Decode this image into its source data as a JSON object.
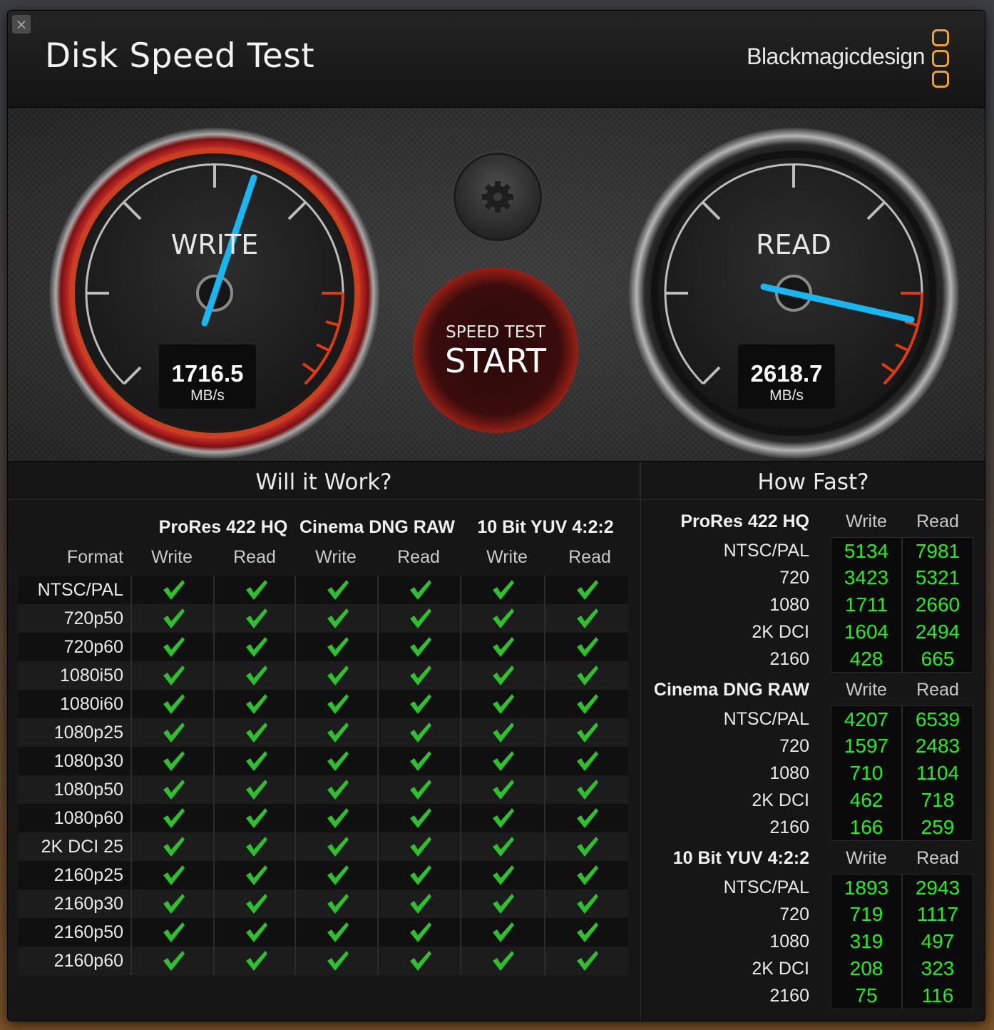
{
  "app": {
    "title": "Disk Speed Test",
    "brand": "Blackmagicdesign",
    "accent_color": "#f0a030"
  },
  "gauges": {
    "write": {
      "label": "WRITE",
      "value": "1716.5",
      "unit": "MB/s",
      "ring_color": "#c42a2a",
      "needle_color": "#1ab6f0"
    },
    "read": {
      "label": "READ",
      "value": "2618.7",
      "unit": "MB/s",
      "ring_color": "#2a2a2a",
      "needle_color": "#1ab6f0"
    }
  },
  "start_button": {
    "subtitle": "SPEED TEST",
    "label": "START"
  },
  "settings_icon": "gear-icon",
  "will_it_work": {
    "title": "Will it Work?",
    "format_header": "Format",
    "groups": [
      "ProRes 422 HQ",
      "Cinema DNG RAW",
      "10 Bit YUV 4:2:2"
    ],
    "subheaders": [
      "Write",
      "Read",
      "Write",
      "Read",
      "Write",
      "Read"
    ],
    "rows": [
      {
        "format": "NTSC/PAL"
      },
      {
        "format": "720p50"
      },
      {
        "format": "720p60"
      },
      {
        "format": "1080i50"
      },
      {
        "format": "1080i60"
      },
      {
        "format": "1080p25"
      },
      {
        "format": "1080p30"
      },
      {
        "format": "1080p50"
      },
      {
        "format": "1080p60"
      },
      {
        "format": "2K DCI 25"
      },
      {
        "format": "2160p25"
      },
      {
        "format": "2160p30"
      },
      {
        "format": "2160p50"
      },
      {
        "format": "2160p60"
      }
    ],
    "check_icon": "check-icon",
    "check_color": "#2fbf2f"
  },
  "how_fast": {
    "title": "How Fast?",
    "blocks": [
      {
        "title": "ProRes 422 HQ",
        "write_header": "Write",
        "read_header": "Read",
        "rows": [
          {
            "label": "NTSC/PAL",
            "write": "5134",
            "read": "7981"
          },
          {
            "label": "720",
            "write": "3423",
            "read": "5321"
          },
          {
            "label": "1080",
            "write": "1711",
            "read": "2660"
          },
          {
            "label": "2K DCI",
            "write": "1604",
            "read": "2494"
          },
          {
            "label": "2160",
            "write": "428",
            "read": "665"
          }
        ]
      },
      {
        "title": "Cinema DNG RAW",
        "write_header": "Write",
        "read_header": "Read",
        "rows": [
          {
            "label": "NTSC/PAL",
            "write": "4207",
            "read": "6539"
          },
          {
            "label": "720",
            "write": "1597",
            "read": "2483"
          },
          {
            "label": "1080",
            "write": "710",
            "read": "1104"
          },
          {
            "label": "2K DCI",
            "write": "462",
            "read": "718"
          },
          {
            "label": "2160",
            "write": "166",
            "read": "259"
          }
        ]
      },
      {
        "title": "10 Bit YUV 4:2:2",
        "write_header": "Write",
        "read_header": "Read",
        "rows": [
          {
            "label": "NTSC/PAL",
            "write": "1893",
            "read": "2943"
          },
          {
            "label": "720",
            "write": "719",
            "read": "1117"
          },
          {
            "label": "1080",
            "write": "319",
            "read": "497"
          },
          {
            "label": "2K DCI",
            "write": "208",
            "read": "323"
          },
          {
            "label": "2160",
            "write": "75",
            "read": "116"
          }
        ]
      }
    ],
    "value_color": "#22ee22"
  }
}
